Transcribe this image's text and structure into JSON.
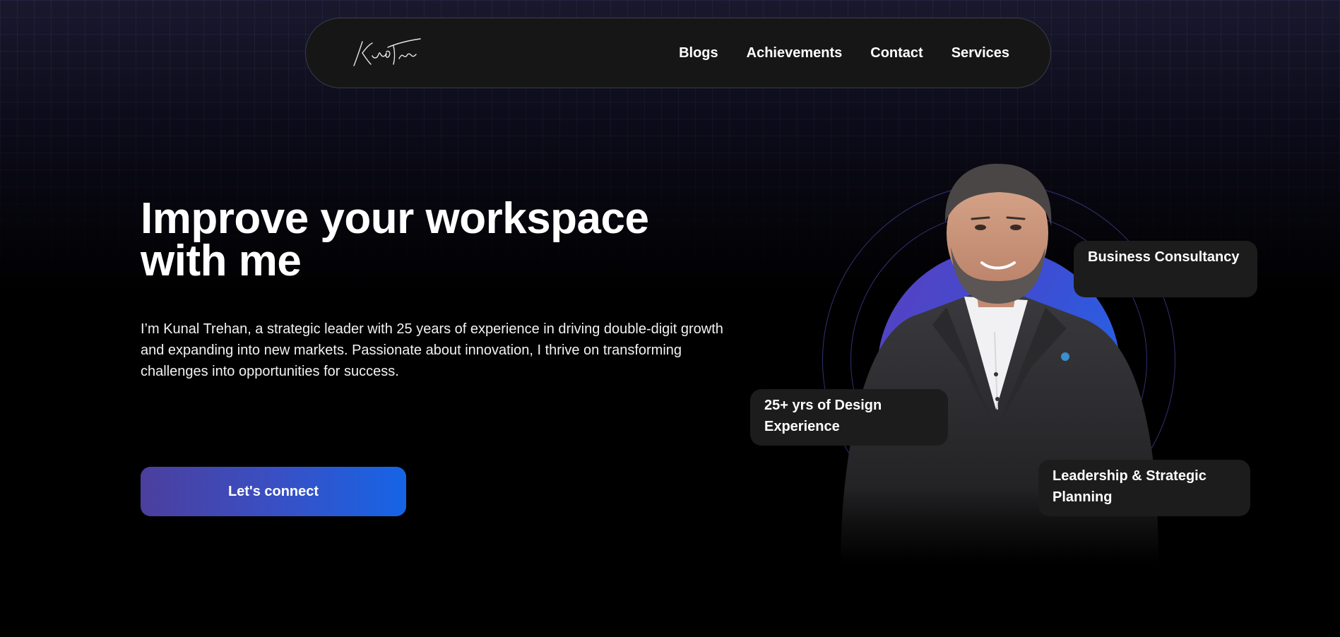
{
  "nav": {
    "logo_text": "Kunal Trehan",
    "links": [
      {
        "label": "Blogs"
      },
      {
        "label": "Achievements"
      },
      {
        "label": "Contact"
      },
      {
        "label": "Services"
      }
    ]
  },
  "hero": {
    "title_line1": "Improve your workspace",
    "title_line2": "with me",
    "description": "I’m Kunal Trehan, a strategic leader with 25 years of experience in driving double-digit growth and expanding into new markets. Passionate about innovation, I thrive on transforming challenges into opportunities for success.",
    "cta_label": "Let's connect"
  },
  "tags": {
    "business": "Business Consultancy",
    "design": "25+ yrs of Design Experience",
    "leadership": "Leadership & Strategic Planning"
  },
  "colors": {
    "background": "#000000",
    "nav_bg": "#161616",
    "accent_start": "#4b3f9e",
    "accent_end": "#1664e6",
    "tag_bg": "#1c1c1c"
  },
  "icons": {
    "logo": "signature-logo"
  }
}
